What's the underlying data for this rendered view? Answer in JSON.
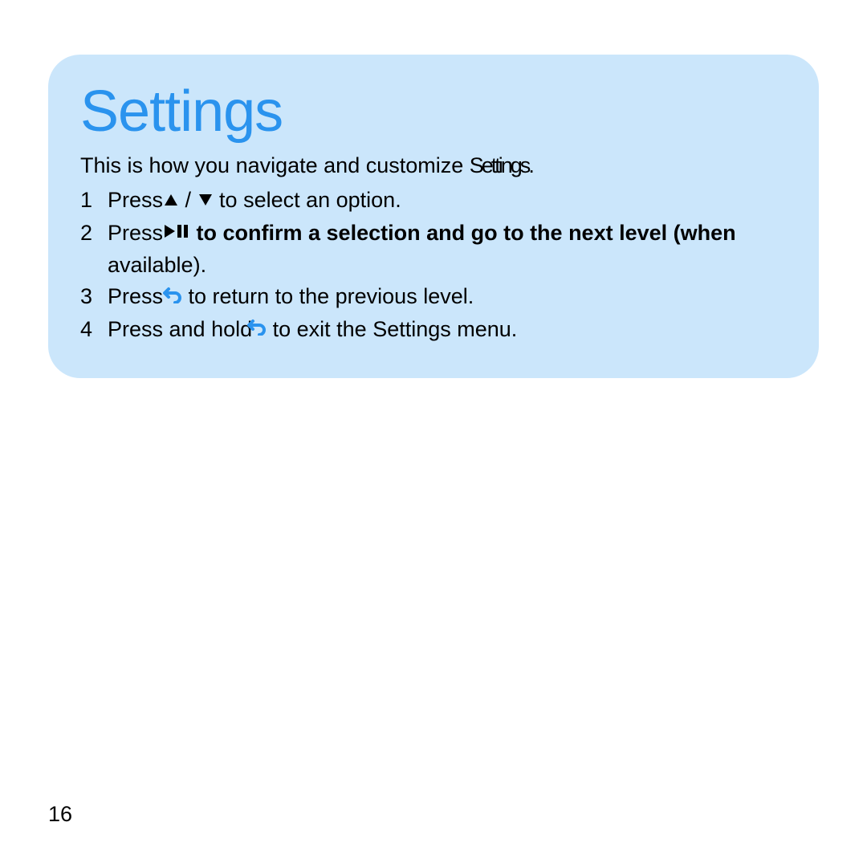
{
  "title": "Settings",
  "intro_pre": "This is how you navigate and customize ",
  "intro_overlap": "Settings",
  "intro_post": ".",
  "steps": {
    "s1": {
      "num": "1",
      "pre": "Press",
      "mid": " / ",
      "post": " to select an option."
    },
    "s2": {
      "num": "2",
      "pre": "Press",
      "bold": " to confirm a selection and go to the next level (when",
      "post": "available)."
    },
    "s3": {
      "num": "3",
      "pre": "Press",
      "post": " to return to the previous level."
    },
    "s4": {
      "num": "4",
      "pre": "Press and hold",
      "post": " to exit the Settings  menu."
    }
  },
  "page_number": "16",
  "colors": {
    "accent": "#2a93ee",
    "card_bg": "#cbe6fb"
  }
}
